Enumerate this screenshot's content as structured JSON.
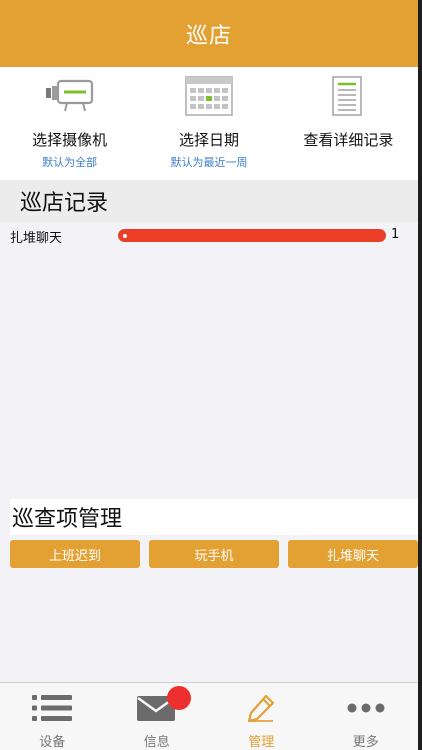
{
  "nav": {
    "title": "巡店"
  },
  "toolbar": {
    "items": [
      {
        "icon": "camera-icon",
        "label": "选择摄像机",
        "sub": "默认为全部"
      },
      {
        "icon": "calendar-icon",
        "label": "选择日期",
        "sub": "默认为最近一周"
      },
      {
        "icon": "document-icon",
        "label": "查看详细记录",
        "sub": ""
      }
    ]
  },
  "records": {
    "title": "巡店记录",
    "rows": [
      {
        "name": "扎堆聊天",
        "count": "1",
        "value": 1
      }
    ],
    "max": 1
  },
  "management": {
    "title": "巡查项管理",
    "buttons": [
      "上班迟到",
      "玩手机",
      "扎堆聊天"
    ]
  },
  "tabbar": {
    "tabs": [
      {
        "icon": "list-icon",
        "label": "设备"
      },
      {
        "icon": "mail-icon",
        "label": "信息"
      },
      {
        "icon": "pencil-icon",
        "label": "管理",
        "active": true
      },
      {
        "icon": "more-icon",
        "label": "更多"
      }
    ]
  },
  "colors": {
    "accent": "#e3a033",
    "bar": "#ea3f26",
    "link": "#3d7fc9",
    "badge": "#ee2f2f"
  }
}
